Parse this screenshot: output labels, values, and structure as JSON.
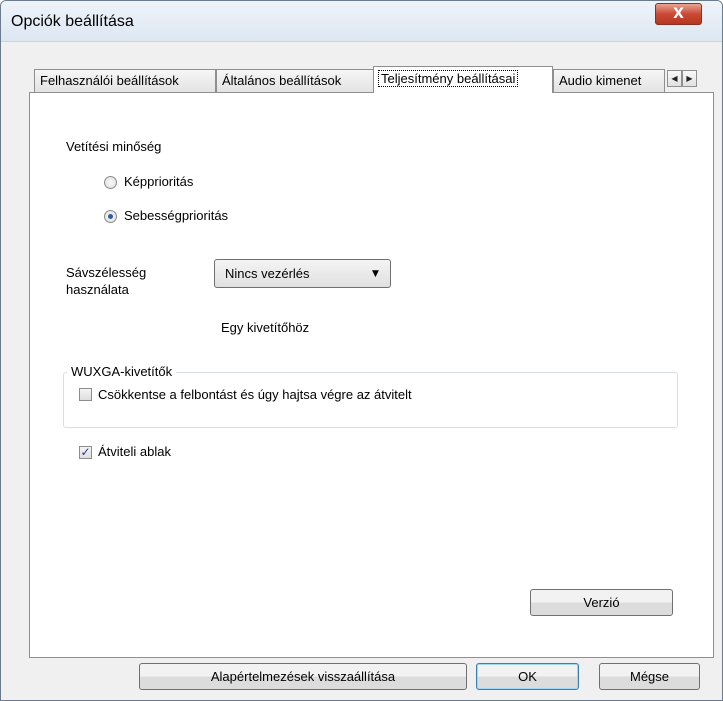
{
  "window": {
    "title": "Opciók beállítása",
    "close_label": "X"
  },
  "tabs": [
    {
      "label": "Felhasználói beállítások"
    },
    {
      "label": "Általános beállítások"
    },
    {
      "label": "Teljesítmény beállításai"
    },
    {
      "label": "Audio kimenet"
    }
  ],
  "tab_scroll": {
    "left": "◀",
    "right": "▶"
  },
  "performance": {
    "projection_quality_label": "Vetítési minőség",
    "radio_image_priority": "Képprioritás",
    "radio_speed_priority": "Sebességprioritás",
    "selected_quality": "Sebességprioritás",
    "bandwidth_label_line1": "Sávszélesség",
    "bandwidth_label_line2": "használata",
    "bandwidth_value": "Nincs vezérlés",
    "bandwidth_note": "Egy kivetítőhöz",
    "wuxga_group_label": "WUXGA-kivetítők",
    "reduce_resolution_label": "Csökkentse a felbontást és úgy hajtsa végre az átvitelt",
    "reduce_resolution_checked": false,
    "transfer_window_label": "Átviteli ablak",
    "transfer_window_checked": true,
    "version_button": "Verzió"
  },
  "footer": {
    "reset_button": "Alapértelmezések visszaállítása",
    "ok_button": "OK",
    "cancel_button": "Mégse"
  }
}
